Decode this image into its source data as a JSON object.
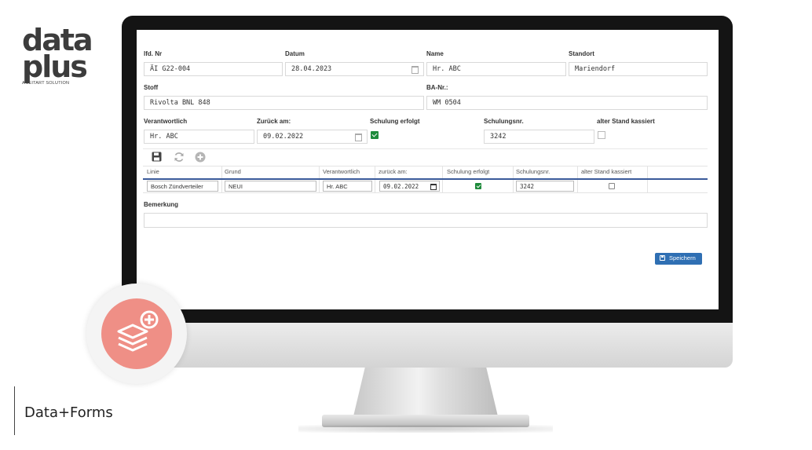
{
  "logo": {
    "line1": "data",
    "line2": "plus",
    "tagline": "A LEITART SOLUTION"
  },
  "product_name": "Data+Forms",
  "form": {
    "lfd_nr": {
      "label": "lfd. Nr",
      "value": "ÄI G22-004"
    },
    "datum": {
      "label": "Datum",
      "value": "28.04.2023"
    },
    "name": {
      "label": "Name",
      "value": "Hr. ABC"
    },
    "standort": {
      "label": "Standort",
      "value": "Mariendorf"
    },
    "stoff": {
      "label": "Stoff",
      "value": "Rivolta BNL 848"
    },
    "ba_nr": {
      "label": "BA-Nr.:",
      "value": "WM 0504"
    },
    "verantwortlich": {
      "label": "Verantwortlich",
      "value": "Hr. ABC"
    },
    "zurueck_am": {
      "label": "Zurück am:",
      "value": "09.02.2022"
    },
    "schulung_erfolgt": {
      "label": "Schulung erfolgt",
      "checked": true
    },
    "schulungsnr": {
      "label": "Schulungsnr.",
      "value": "3242"
    },
    "alter_stand": {
      "label": "alter Stand kassiert",
      "checked": false
    },
    "bemerkung": {
      "label": "Bemerkung",
      "value": ""
    }
  },
  "toolbar": {
    "icons": [
      "save-icon",
      "refresh-icon",
      "add-circle-icon"
    ]
  },
  "grid": {
    "headers": [
      "Linie",
      "Grund",
      "Verantwortlich",
      "zurück am:",
      "Schulung erfolgt",
      "Schulungsnr.",
      "alter Stand kassiert"
    ],
    "row": {
      "linie": "Bosch Zündverteiler",
      "grund": "NEUI",
      "verantwortlich": "Hr. ABC",
      "zurueck_am": "09.02.2022",
      "schulung_erfolgt": true,
      "schulungsnr": "3242",
      "alter_stand": false
    }
  },
  "save_button": {
    "label": "Speichern"
  },
  "colors": {
    "accent": "#2f6fb3",
    "check": "#1e8a3b",
    "badge": "#ef8f86",
    "grid_line": "#3a5a9a"
  }
}
